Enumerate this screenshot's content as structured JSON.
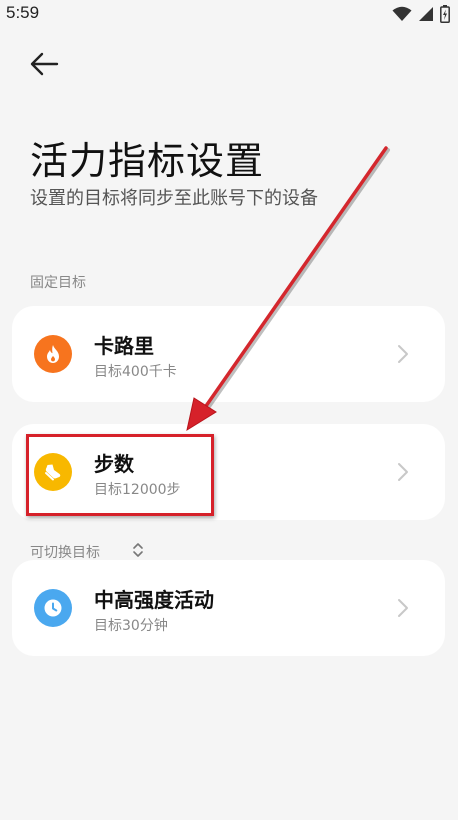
{
  "status_bar": {
    "time": "5:59"
  },
  "header": {
    "title": "活力指标设置",
    "subtitle": "设置的目标将同步至此账号下的设备"
  },
  "fixed_section": {
    "label": "固定目标",
    "items": [
      {
        "title": "卡路里",
        "desc": "目标400千卡",
        "icon": "flame-icon",
        "color": "#f7741e"
      },
      {
        "title": "步数",
        "desc": "目标12000步",
        "icon": "shoe-icon",
        "color": "#f8b800"
      }
    ]
  },
  "switchable_section": {
    "label": "可切换目标",
    "items": [
      {
        "title": "中高强度活动",
        "desc": "目标30分钟",
        "icon": "clock-icon",
        "color": "#4aa8ef"
      }
    ]
  },
  "annotation": {
    "color": "#d6212a"
  }
}
